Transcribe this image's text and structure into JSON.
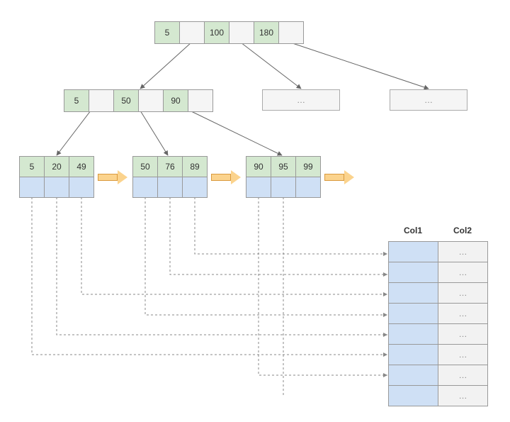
{
  "root": {
    "keys": [
      "5",
      "100",
      "180"
    ]
  },
  "internal_left": {
    "keys": [
      "5",
      "50",
      "90"
    ]
  },
  "internal_placeholders": {
    "text": "…"
  },
  "leaves": [
    {
      "keys": [
        "5",
        "20",
        "49"
      ]
    },
    {
      "keys": [
        "50",
        "76",
        "89"
      ]
    },
    {
      "keys": [
        "90",
        "95",
        "99"
      ]
    }
  ],
  "table": {
    "headers": [
      "Col1",
      "Col2"
    ],
    "rows": [
      {
        "c1": "",
        "c2": "…"
      },
      {
        "c1": "",
        "c2": "…"
      },
      {
        "c1": "",
        "c2": "…"
      },
      {
        "c1": "",
        "c2": "…"
      },
      {
        "c1": "",
        "c2": "…"
      },
      {
        "c1": "",
        "c2": "…"
      },
      {
        "c1": "",
        "c2": "…"
      },
      {
        "c1": "",
        "c2": "…"
      }
    ]
  }
}
